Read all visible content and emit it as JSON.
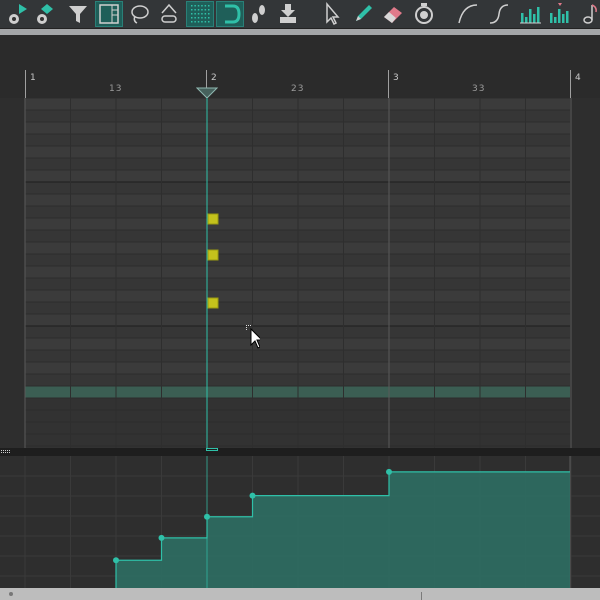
{
  "toolbar": {
    "tools": [
      {
        "name": "play-alt-icon",
        "active": false
      },
      {
        "name": "loop-play-icon",
        "active": false
      },
      {
        "name": "filter-icon",
        "active": false
      },
      {
        "name": "piano-roll-view-icon",
        "active": true
      },
      {
        "name": "lasso-icon",
        "active": false
      },
      {
        "name": "link-icon",
        "active": false
      },
      {
        "name": "grid-icon",
        "active": true
      },
      {
        "name": "magnet-icon",
        "active": true
      },
      {
        "name": "footstep-icon",
        "active": false
      },
      {
        "name": "download-icon",
        "active": false
      },
      {
        "name": "pointer-icon",
        "active": false
      },
      {
        "name": "pencil-icon",
        "active": false
      },
      {
        "name": "eraser-icon",
        "active": false
      },
      {
        "name": "metronome-icon",
        "active": false
      },
      {
        "name": "curve-icon",
        "active": false
      },
      {
        "name": "s-curve-icon",
        "active": false
      },
      {
        "name": "velocity-bars-icon",
        "active": false
      },
      {
        "name": "velocity-bars-alt-icon",
        "active": false
      },
      {
        "name": "note-icon",
        "active": false
      }
    ]
  },
  "ruler": {
    "bars": [
      "1",
      "2",
      "3",
      "4"
    ],
    "beats": [
      "13",
      "23",
      "33"
    ]
  },
  "colors": {
    "accent": "#2fc0a8",
    "note": "#c4c21c",
    "highlight_row": "#3b5e53",
    "velocity_fill": "#2e6e63"
  },
  "notes": [
    {
      "beat": 5.0,
      "row": 10
    },
    {
      "beat": 5.0,
      "row": 13
    },
    {
      "beat": 5.0,
      "row": 17
    }
  ],
  "velocity": {
    "steps": [
      {
        "beat": 3.0,
        "level": 0.21
      },
      {
        "beat": 4.0,
        "level": 0.38
      },
      {
        "beat": 5.0,
        "level": 0.54
      },
      {
        "beat": 6.0,
        "level": 0.7
      },
      {
        "beat": 9.0,
        "level": 0.88
      }
    ]
  }
}
